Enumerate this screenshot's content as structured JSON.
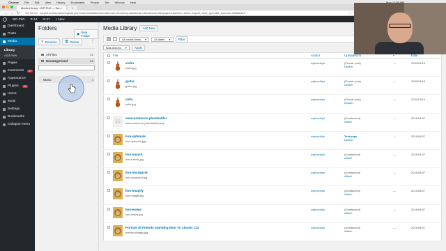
{
  "mac_menu": [
    "Chrome",
    "File",
    "Edit",
    "View",
    "History",
    "Bookmarks",
    "People",
    "Tab",
    "Window",
    "Help"
  ],
  "mac_time": "Mon 12:55 PM",
  "tabs": [
    "Media Library ‹ WP-PhD — Wo",
    "×"
  ],
  "address": {
    "not_secure": "Not Secure",
    "url": "wp-phd.com/wp-admin/upload.php?mode=list&attachment-filter=&m=0&orderby=date&order=desc&mode=list&paged=1&action=-1&fbv=-1&post_mime_type=all&_wpnonce=9fd8d8c6e2"
  },
  "adminbar": {
    "site": "WP-PhD",
    "updates": "14",
    "comments": "27",
    "new": "+ New"
  },
  "sidebar": {
    "items": [
      {
        "label": "Dashboard"
      },
      {
        "label": "Posts"
      },
      {
        "label": "Media"
      },
      {
        "label": "Pages"
      },
      {
        "label": "Comments",
        "badge": "27"
      },
      {
        "label": "Appearance"
      },
      {
        "label": "Plugins",
        "badge": "10"
      },
      {
        "label": "Users"
      },
      {
        "label": "Tools"
      },
      {
        "label": "Settings"
      },
      {
        "label": "Bookmarks"
      },
      {
        "label": "Collapse menu"
      }
    ],
    "submenu": [
      "Library",
      "Add New"
    ]
  },
  "folders": {
    "title": "Folders",
    "new_folder": "New Folder",
    "rename": "Rename",
    "delete": "Delete",
    "all_files": "All Files",
    "all_files_count": "45",
    "uncategorized": "Uncategorized",
    "uncategorized_count": "44",
    "music": "Music",
    "music_count": "1"
  },
  "library": {
    "title": "Media Library",
    "add_new": "Add New",
    "filter_type": "All media items",
    "filter_date": "All dates",
    "filter_btn": "Filter",
    "bulk": "Bulk Actions",
    "apply": "Apply",
    "count": "45 items",
    "columns": [
      "File",
      "Author",
      "Uploaded to",
      "",
      "Date"
    ]
  },
  "rows": [
    {
      "name": "violin",
      "file": "violin.jpg",
      "author": "wpfewolfpd",
      "up1": "(Private post)",
      "up2": "Detach",
      "cm": "—",
      "date": "2020/03/16",
      "thumb": "violin"
    },
    {
      "name": "guitar",
      "file": "guitar.jpg",
      "author": "wpfewolfpd",
      "up1": "(Private post)",
      "up2": "Detach",
      "cm": "—",
      "date": "2020/03/16",
      "thumb": "violin"
    },
    {
      "name": "cello",
      "file": "cello.jpg",
      "author": "wpfewolfpd",
      "up1": "(Private post)",
      "up2": "Detach",
      "cm": "—",
      "date": "2020/03/16",
      "thumb": "violin"
    },
    {
      "name": "woocommerce-placeholder",
      "file": "woocommerce-placeholder.png",
      "author": "wpfewolfpd",
      "up1": "(Unattached)",
      "up2": "Attach",
      "cm": "—",
      "date": "2019/04/07",
      "thumb": "placeholder"
    },
    {
      "name": "lion-optimole",
      "file": "lion-optimole.jpg",
      "author": "wpfewolfpd",
      "up1": "Test page",
      "up2": "Detach",
      "cm": "—",
      "date": "2019/04/07",
      "thumb": "lion"
    },
    {
      "name": "lion-smush",
      "file": "lion-smush.jpg",
      "author": "wpfewolfpd",
      "up1": "(Unattached)",
      "up2": "Attach",
      "cm": "—",
      "date": "2019/04/07",
      "thumb": "lion"
    },
    {
      "name": "lion-shortpixel",
      "file": "lion-shortpixel.jpg",
      "author": "wpfewolfpd",
      "up1": "(Unattached)",
      "up2": "Attach",
      "cm": "—",
      "date": "2019/04/07",
      "thumb": "lion"
    },
    {
      "name": "lion-imagify",
      "file": "lion-imagify.jpg",
      "author": "wpfewolfpd",
      "up1": "(Unattached)",
      "up2": "Attach",
      "cm": "—",
      "date": "2019/04/07",
      "thumb": "lion"
    },
    {
      "name": "lion-ewww",
      "file": "lion-ewww.jpg",
      "author": "wpfewolfpd",
      "up1": "(Unattached)",
      "up2": "Attach",
      "cm": "—",
      "date": "2019/04/07",
      "thumb": "lion"
    },
    {
      "name": "Portrait Of Friends Standing Next To Classic Car",
      "file": "friends-imagify.jpg",
      "author": "wpfewolfpd",
      "up1": "(Unattached)",
      "up2": "Attach",
      "cm": "—",
      "date": "2019/04/07",
      "thumb": "lion"
    }
  ],
  "colors": {
    "admin_dark": "#23282d",
    "accent": "#0073aa",
    "badge": "#d63638"
  }
}
